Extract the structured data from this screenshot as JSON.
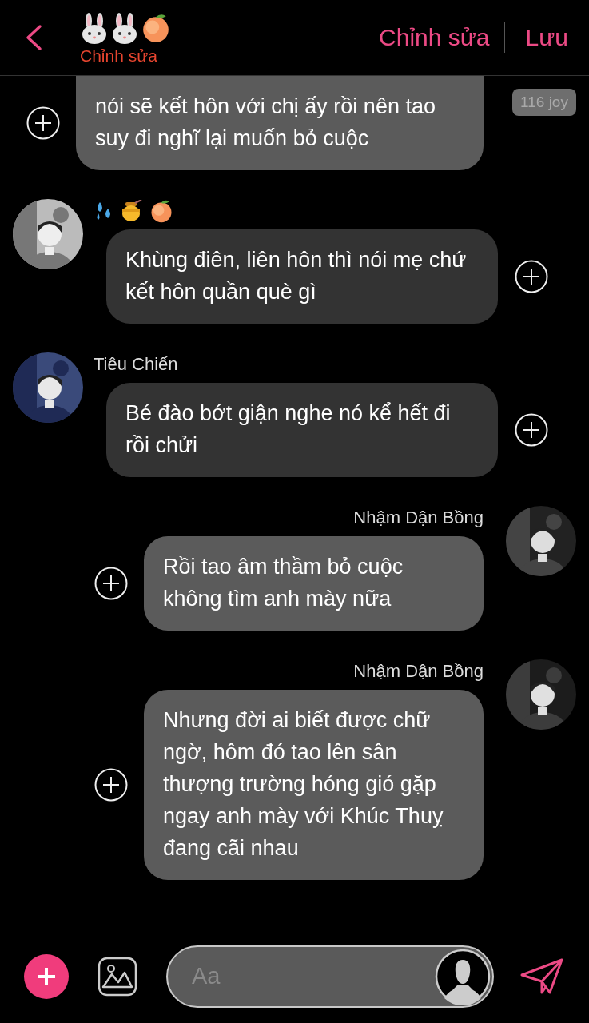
{
  "header": {
    "subtitle": "Chỉnh sửa",
    "actions": [
      "Chỉnh sửa",
      "Lưu"
    ]
  },
  "messages": [
    {
      "kind": "outgoing",
      "avatar": false,
      "emoji_name": false,
      "badge": "116 joy",
      "cut_top": true,
      "text": "nói sẽ kết hôn với chị ấy rồi nên tao suy đi nghĩ lại muốn bỏ cuộc"
    },
    {
      "kind": "incoming",
      "avatar": true,
      "emoji_name": true,
      "cut_top": false,
      "text": "Khùng điên, liên hôn thì nói mẹ chứ kết hôn quần què gì"
    },
    {
      "kind": "incoming",
      "avatar": true,
      "emoji_name": false,
      "cut_top": false,
      "sender": "Tiêu Chiến",
      "text": "Bé đào bớt giận nghe nó kể hết đi rồi chửi"
    },
    {
      "kind": "outgoing",
      "avatar": true,
      "emoji_name": false,
      "cut_top": false,
      "sender": "Nhậm Dận Bồng",
      "text": "Rồi tao âm thầm bỏ cuộc không tìm anh mày nữa"
    },
    {
      "kind": "outgoing",
      "avatar": true,
      "emoji_name": false,
      "cut_top": false,
      "sender": "Nhậm Dận Bồng",
      "text": "Nhưng đời ai biết được chữ ngờ, hôm đó tao lên sân thượng trường hóng gió gặp ngay anh mày với Khúc Thuỵ đang cãi nhau"
    }
  ],
  "composer": {
    "placeholder": "Aa"
  }
}
